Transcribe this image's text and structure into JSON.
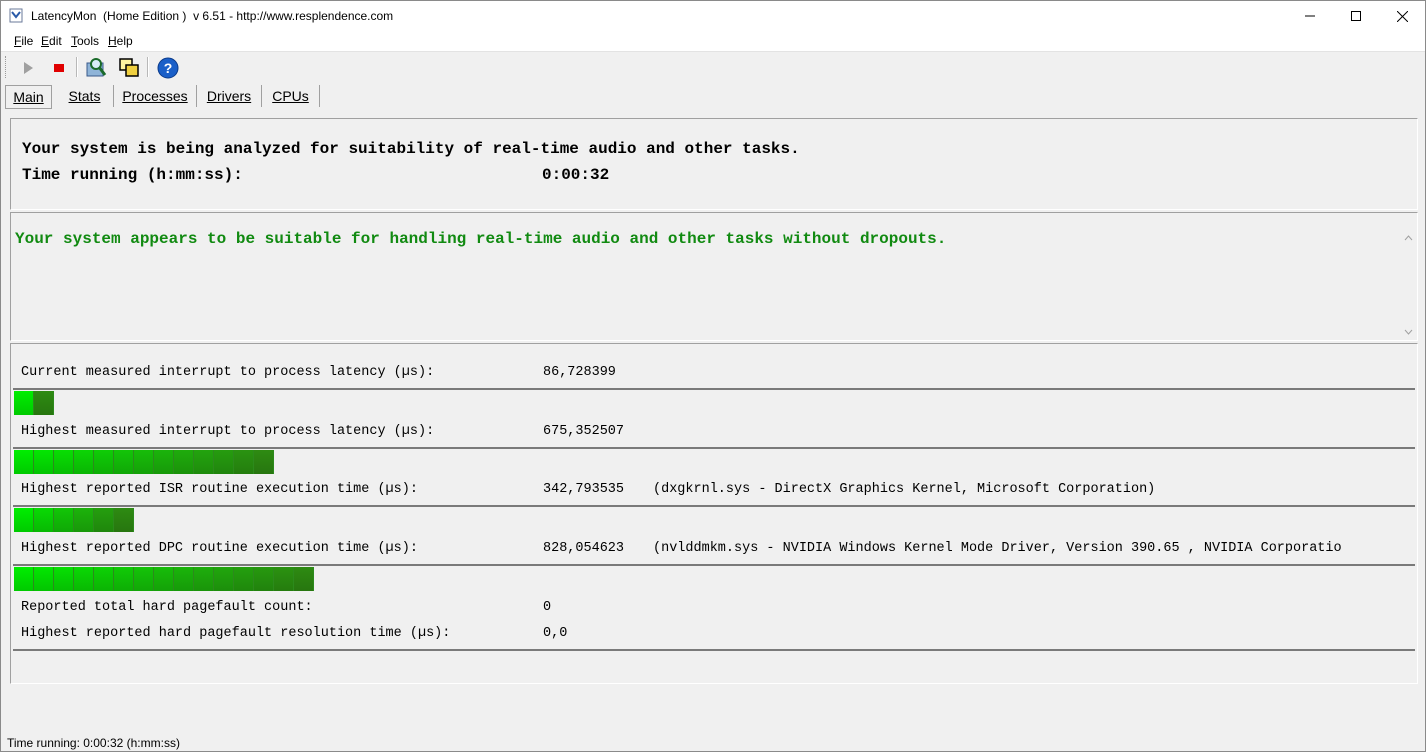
{
  "window": {
    "title": "LatencyMon  (Home Edition )  v 6.51 - http://www.resplendence.com"
  },
  "menu": {
    "items": [
      {
        "key": "F",
        "rest": "ile"
      },
      {
        "key": "E",
        "rest": "dit"
      },
      {
        "key": "T",
        "rest": "ools"
      },
      {
        "key": "H",
        "rest": "elp"
      }
    ]
  },
  "toolbar": {
    "icons": [
      "play-icon",
      "stop-icon",
      "search-drivers-icon",
      "windows-icon",
      "help-icon"
    ]
  },
  "tabs": [
    {
      "label": "Main",
      "active": true
    },
    {
      "label": "Stats",
      "active": false
    },
    {
      "label": "Processes",
      "active": false
    },
    {
      "label": "Drivers",
      "active": false
    },
    {
      "label": "CPUs",
      "active": false
    }
  ],
  "summary": {
    "heading": "Your system is being analyzed for suitability of real-time audio and other tasks.",
    "time_label": "Time running (h:mm:ss):",
    "time_value": "0:00:32"
  },
  "conclusion": {
    "text": "Your system appears to be suitable for handling real-time audio and other tasks without dropouts.",
    "color": "#118a11"
  },
  "metrics": {
    "current_latency": {
      "label": "Current measured interrupt to process latency (µs):",
      "value": "86,728399",
      "bar_segments": 2
    },
    "highest_latency": {
      "label": "Highest measured interrupt to process latency (µs):",
      "value": "675,352507",
      "bar_segments": 13
    },
    "isr": {
      "label": "Highest reported ISR routine execution time (µs):",
      "value": "342,793535",
      "detail": "(dxgkrnl.sys - DirectX Graphics Kernel, Microsoft Corporation)",
      "bar_segments": 6
    },
    "dpc": {
      "label": "Highest reported DPC routine execution time (µs):",
      "value": "828,054623",
      "detail": "(nvlddmkm.sys - NVIDIA Windows Kernel Mode Driver, Version 390.65 , NVIDIA Corporatio",
      "bar_segments": 15
    },
    "pagefault_count": {
      "label": "Reported total hard pagefault count:",
      "value": "0"
    },
    "pagefault_time": {
      "label": "Highest reported hard pagefault resolution time (µs):",
      "value": "0,0",
      "bar_segments": 0
    }
  },
  "status": {
    "text": "Time running: 0:00:32  (h:mm:ss)"
  },
  "colors": {
    "bar_bright": "#00ee00",
    "bar_dark": "#2e8b12"
  }
}
